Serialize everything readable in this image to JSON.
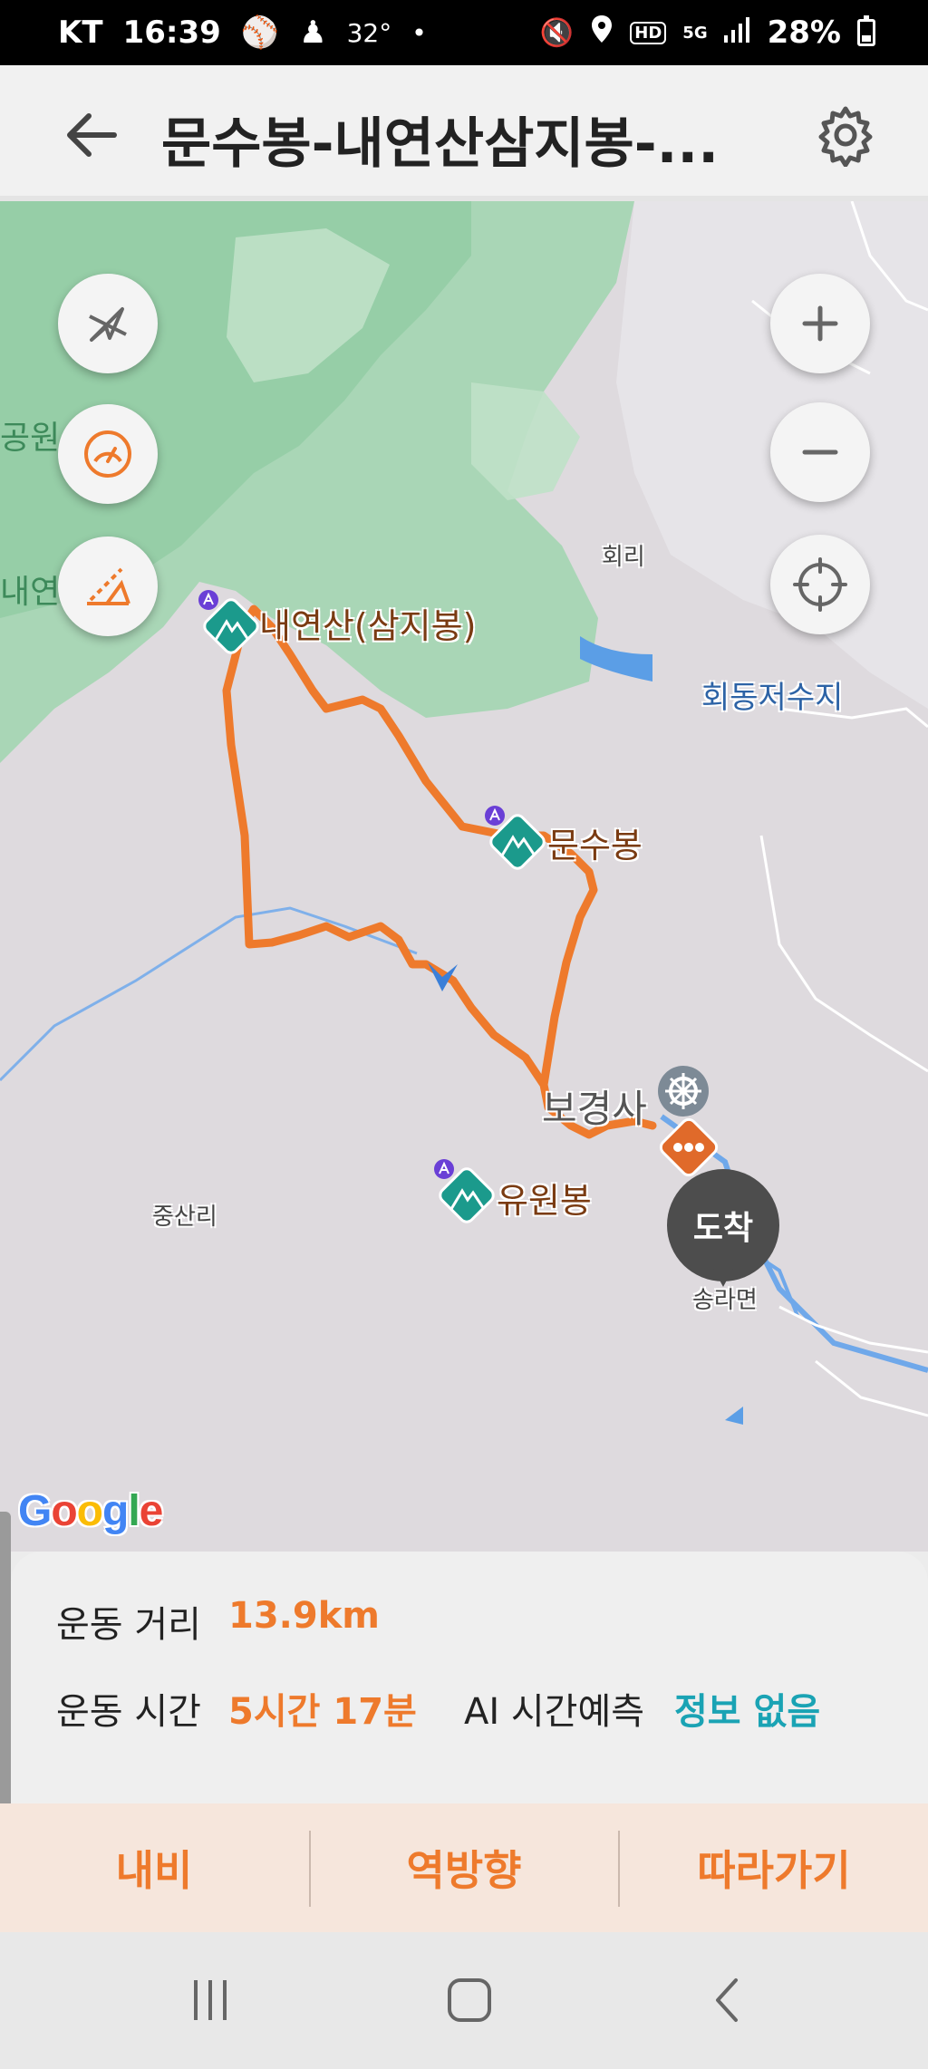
{
  "status_bar": {
    "carrier": "KT",
    "time": "16:39",
    "temperature": "32°",
    "dot": "•",
    "network_badge_hd": "HD",
    "network_badge_5g": "5G",
    "battery": "28%"
  },
  "app_bar": {
    "title": "문수봉-내연산삼지봉-...",
    "back_icon": "arrow-left-icon",
    "settings_icon": "gear-icon"
  },
  "map": {
    "controls_left": [
      {
        "icon": "compass-off-icon"
      },
      {
        "icon": "speedometer-icon"
      },
      {
        "icon": "elevation-icon"
      }
    ],
    "controls_right": [
      {
        "icon": "zoom-in-icon",
        "glyph": "+"
      },
      {
        "icon": "zoom-out-icon",
        "glyph": "−"
      },
      {
        "icon": "locate-icon"
      }
    ],
    "labels": {
      "peak_1": "내연산(삼지봉)",
      "peak_2": "문수봉",
      "peak_3": "유원봉",
      "village_1": "회리",
      "village_2": "중산리",
      "village_3": "송라면",
      "reservoir": "회동저수지",
      "temple": "보경사",
      "edge_1": "공원",
      "edge_2": "내연"
    },
    "arrival_pin": "도착",
    "google_logo": [
      "G",
      "o",
      "o",
      "g",
      "l",
      "e"
    ],
    "colors": {
      "route": "#ee7a2c",
      "forest": "#a9d6b6",
      "forest_dark": "#8fcaa1",
      "water": "#5b9ee6",
      "peak_marker": "#1b9a8c"
    }
  },
  "summary": {
    "distance_label": "운동 거리",
    "distance_value": "13.9km",
    "time_label": "운동 시간",
    "time_value": "5시간 17분",
    "ai_label": "AI 시간예측",
    "ai_value": "정보 없음"
  },
  "actions": {
    "navigate": "내비",
    "reverse": "역방향",
    "follow": "따라가기"
  },
  "system_nav": {
    "recents_icon": "recents-icon",
    "home_icon": "home-icon",
    "back_icon": "back-chevron-icon"
  }
}
